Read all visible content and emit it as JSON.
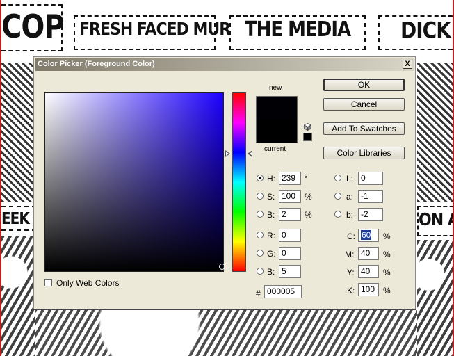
{
  "background": {
    "panels": [
      "COP",
      "FRESH FACED MURPHY",
      "THE MEDIA",
      "DICK J",
      "EEK LE",
      "ON AN"
    ]
  },
  "dialog": {
    "title": "Color Picker (Foreground Color)",
    "close_label": "X",
    "preview": {
      "new_label": "new",
      "current_label": "current",
      "new_color": "#000005",
      "current_color": "#000000"
    },
    "buttons": {
      "ok": "OK",
      "cancel": "Cancel",
      "add_to_swatches": "Add To Swatches",
      "color_libraries": "Color Libraries"
    },
    "hsb": [
      {
        "label": "H:",
        "value": "239",
        "unit": "°",
        "selected": true
      },
      {
        "label": "S:",
        "value": "100",
        "unit": "%",
        "selected": false
      },
      {
        "label": "B:",
        "value": "2",
        "unit": "%",
        "selected": false
      }
    ],
    "rgb": [
      {
        "label": "R:",
        "value": "0"
      },
      {
        "label": "G:",
        "value": "0"
      },
      {
        "label": "B:",
        "value": "5"
      }
    ],
    "lab": [
      {
        "label": "L:",
        "value": "0"
      },
      {
        "label": "a:",
        "value": "-1"
      },
      {
        "label": "b:",
        "value": "-2"
      }
    ],
    "cmyk": [
      {
        "label": "C:",
        "value": "60",
        "unit": "%"
      },
      {
        "label": "M:",
        "value": "40",
        "unit": "%"
      },
      {
        "label": "Y:",
        "value": "40",
        "unit": "%"
      },
      {
        "label": "K:",
        "value": "100",
        "unit": "%"
      }
    ],
    "hex_label": "#",
    "hex_value": "000005",
    "only_web_colors_label": "Only Web Colors",
    "only_web_colors_checked": false,
    "hue_color": "#1c00ff"
  }
}
